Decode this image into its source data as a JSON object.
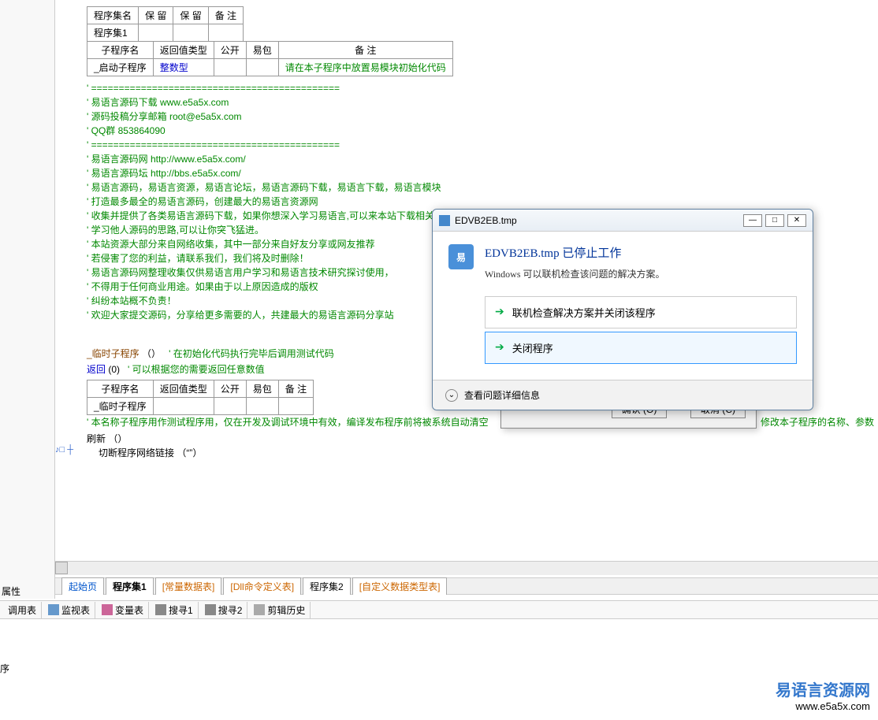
{
  "sidebar": {
    "properties_label": "属性"
  },
  "table_assembly": {
    "headers": [
      "程序集名",
      "保 留",
      "保 留",
      "备 注"
    ],
    "row": [
      "程序集1",
      "",
      "",
      ""
    ]
  },
  "table_sub": {
    "headers": [
      "子程序名",
      "返回值类型",
      "公开",
      "易包",
      "备 注"
    ],
    "row": {
      "name": "_启动子程序",
      "rettype": "整数型",
      "pub": "",
      "pkg": "",
      "note": "请在本子程序中放置易模块初始化代码"
    }
  },
  "comments": [
    "' =============================================",
    "' 易语言源码下载    www.e5a5x.com",
    "' 源码投稿分享邮箱  root@e5a5x.com",
    "' QQ群     853864090",
    "' =============================================",
    "' 易语言源码网 http://www.e5a5x.com/",
    "' 易语言源码坛 http://bbs.e5a5x.com/",
    "' 易语言源码，易语言资源，易语言论坛，易语言源码下载，易语言下载，易语言模块",
    "' 打造最多最全的易语言源码，创建最大的易语言资源网",
    "' 收集并提供了各类易语言源码下载，如果你想深入学习易语言,可以来本站下载相关学习源码",
    "' 学习他人源码的思路,可以让你突飞猛进。",
    "' 本站资源大部分来自网络收集，其中一部分来自好友分享或网友推荐",
    "' 若侵害了您的利益，请联系我们，我们将及时删除！",
    "' 易语言源码网整理收集仅供易语言用户学习和易语言技术研究探讨使用，",
    "' 不得用于任何商业用途。如果由于以上原因造成的版权",
    "' 纠纷本站概不负责！",
    "' 欢迎大家提交源码，分享给更多需要的人，共建最大的易语言源码分享站"
  ],
  "call_line": {
    "name": "_临时子程序",
    "args": "（）",
    "comment": "' 在初始化代码执行完毕后调用测试代码"
  },
  "return_line": {
    "kw": "返回",
    "val": "(0)",
    "comment": "' 可以根据您的需要返回任意数值"
  },
  "table_temp": {
    "headers": [
      "子程序名",
      "返回值类型",
      "公开",
      "易包",
      "备 注"
    ],
    "row": {
      "name": "_临时子程序"
    }
  },
  "comment3": "' 本名称子程序用作测试程序用，仅在开发及调试环境中有效，编译发布程序前将被系统自动清空",
  "refresh_line": {
    "kw": "刷新",
    "args": "（）"
  },
  "last_line": {
    "text": "切断程序网络链接",
    "args": "（“”）"
  },
  "doc_tabs": [
    "起始页",
    "程序集1",
    "[常量数据表]",
    "[Dll命令定义表]",
    "程序集2",
    "[自定义数据类型表]"
  ],
  "bottom_tabs": [
    "调用表",
    "监视表",
    "变量表",
    "搜寻1",
    "搜寻2",
    "剪辑历史"
  ],
  "status_char": "序",
  "back_dialog": {
    "ok": "确认 (O)",
    "cancel": "取消 (C)"
  },
  "back_text": "修改本子程序的名称、参数",
  "error_dialog": {
    "title": "EDVB2EB.tmp",
    "main": "EDVB2EB.tmp 已停止工作",
    "sub": "Windows 可以联机检查该问题的解决方案。",
    "action1": "联机检查解决方案并关闭该程序",
    "action2": "关闭程序",
    "details": "查看问题详细信息"
  },
  "watermark": {
    "cn": "易语言资源网",
    "url": "www.e5a5x.com"
  }
}
